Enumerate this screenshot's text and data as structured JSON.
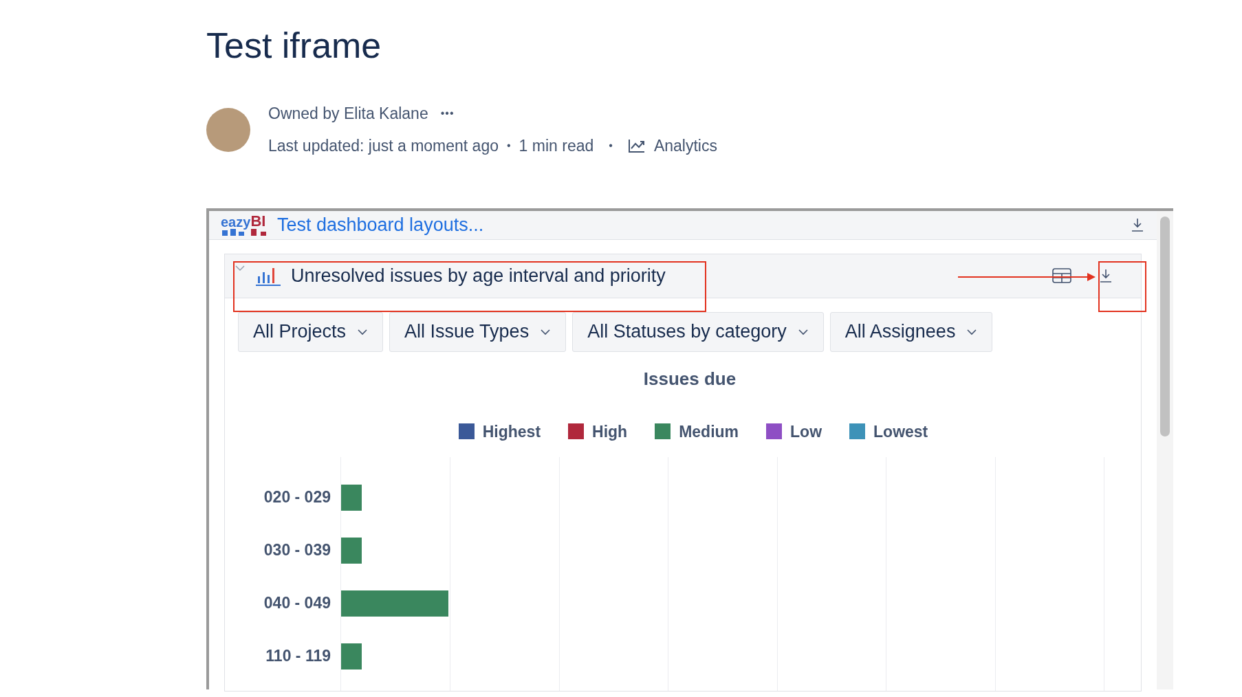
{
  "page": {
    "title": "Test iframe"
  },
  "byline": {
    "owner": "Owned by Elita Kalane",
    "more": "•••",
    "updated": "Last updated: just a moment ago",
    "sep1": "•",
    "read_time": "1 min read",
    "sep2": "•",
    "analytics": "Analytics"
  },
  "dashboard": {
    "logo": [
      "eazy",
      "BI"
    ],
    "title": "Test dashboard layouts...",
    "report": {
      "title": "Unresolved issues by age interval and priority",
      "expanded": true,
      "filters": [
        "All Projects",
        "All Issue Types",
        "All Statuses by category",
        "All Assignees"
      ],
      "chart_title": "Issues due",
      "legend": [
        {
          "label": "Highest",
          "color": "#3b5998"
        },
        {
          "label": "High",
          "color": "#b0283c"
        },
        {
          "label": "Medium",
          "color": "#3a875e"
        },
        {
          "label": "Low",
          "color": "#8e4fc4"
        },
        {
          "label": "Lowest",
          "color": "#3d92b8"
        }
      ],
      "rows": [
        {
          "label": "020 - 029",
          "level": 0.027
        },
        {
          "label": "030 - 039",
          "level": 0.027
        },
        {
          "label": "040 - 049",
          "level": 0.141
        },
        {
          "label": "110 - 119",
          "level": 0.027
        }
      ]
    }
  }
}
